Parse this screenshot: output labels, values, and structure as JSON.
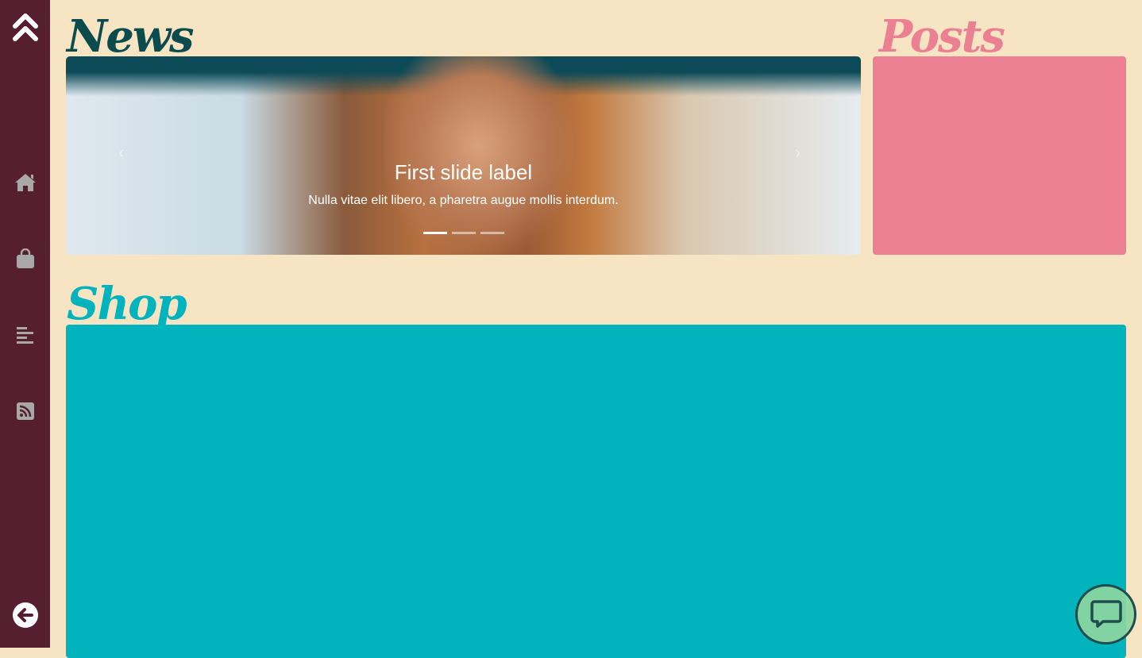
{
  "sidebar": {
    "items": [
      {
        "icon": "chevrons-up-icon"
      },
      {
        "icon": "home-icon"
      },
      {
        "icon": "shopping-bag-icon"
      },
      {
        "icon": "align-left-icon"
      },
      {
        "icon": "rss-icon"
      },
      {
        "icon": "arrow-left-circle-icon"
      }
    ]
  },
  "sections": {
    "news": "News",
    "posts": "Posts",
    "shop": "Shop"
  },
  "carousel": {
    "title": "First slide label",
    "text": "Nulla vitae elit libero, a pharetra augue mollis interdum.",
    "prev": "‹",
    "next": "›",
    "slides": 3,
    "active": 1
  },
  "colors": {
    "sidebar": "#561f30",
    "background": "#f7e4c3",
    "news": "#0b4a4d",
    "posts": "#eb8093",
    "shop": "#00b3bc",
    "chat": "#8cd6a0"
  }
}
